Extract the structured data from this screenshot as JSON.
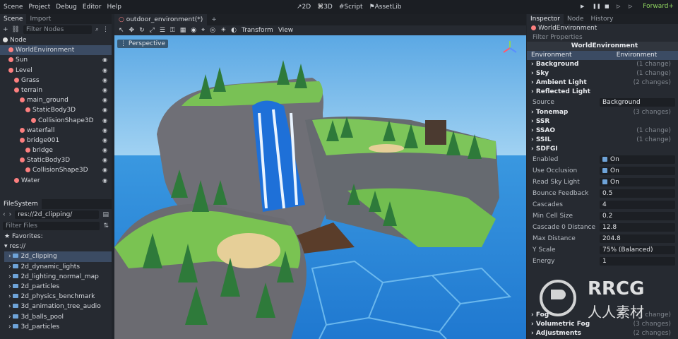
{
  "menu": [
    "Scene",
    "Project",
    "Debug",
    "Editor",
    "Help"
  ],
  "modes": [
    "2D",
    "3D",
    "Script",
    "AssetLib"
  ],
  "renderer": "Forward+",
  "scene_panel": {
    "tabs": [
      "Scene",
      "Import"
    ],
    "filter_placeholder": "Filter Nodes",
    "tree": [
      {
        "label": "Node",
        "indent": 0,
        "color": "#e0e0e0",
        "eye": false,
        "selected": false
      },
      {
        "label": "WorldEnvironment",
        "indent": 1,
        "color": "#fc7f7f",
        "eye": false,
        "selected": true
      },
      {
        "label": "Sun",
        "indent": 1,
        "color": "#fc7f7f",
        "eye": true,
        "selected": false
      },
      {
        "label": "Level",
        "indent": 1,
        "color": "#fc7f7f",
        "eye": true,
        "selected": false
      },
      {
        "label": "Grass",
        "indent": 2,
        "color": "#fc7f7f",
        "eye": true,
        "selected": false
      },
      {
        "label": "terrain",
        "indent": 2,
        "color": "#fc7f7f",
        "eye": true,
        "selected": false
      },
      {
        "label": "main_ground",
        "indent": 3,
        "color": "#fc7f7f",
        "eye": true,
        "selected": false
      },
      {
        "label": "StaticBody3D",
        "indent": 4,
        "color": "#fc7f7f",
        "eye": true,
        "selected": false
      },
      {
        "label": "CollisionShape3D",
        "indent": 5,
        "color": "#fc7f7f",
        "eye": true,
        "selected": false
      },
      {
        "label": "waterfall",
        "indent": 3,
        "color": "#fc7f7f",
        "eye": true,
        "selected": false
      },
      {
        "label": "bridge001",
        "indent": 3,
        "color": "#fc7f7f",
        "eye": true,
        "selected": false
      },
      {
        "label": "bridge",
        "indent": 4,
        "color": "#fc7f7f",
        "eye": true,
        "selected": false
      },
      {
        "label": "StaticBody3D",
        "indent": 3,
        "color": "#fc7f7f",
        "eye": true,
        "selected": false
      },
      {
        "label": "CollisionShape3D",
        "indent": 4,
        "color": "#fc7f7f",
        "eye": true,
        "selected": false
      },
      {
        "label": "Water",
        "indent": 2,
        "color": "#fc7f7f",
        "eye": true,
        "selected": false
      }
    ]
  },
  "filesystem": {
    "tab": "FileSystem",
    "path": "res://2d_clipping/",
    "filter_placeholder": "Filter Files",
    "favorites": "Favorites:",
    "root": "res://",
    "items": [
      "2d_clipping",
      "2d_dynamic_lights",
      "2d_lighting_normal_map",
      "2d_particles",
      "2d_physics_benchmark",
      "3d_animation_tree_audio",
      "3d_balls_pool",
      "3d_particles"
    ],
    "selected_index": 0
  },
  "viewport": {
    "tab_label": "outdoor_environment(*)",
    "menus": [
      "Transform",
      "View"
    ],
    "perspective": "Perspective"
  },
  "inspector": {
    "tabs": [
      "Inspector",
      "Node",
      "History"
    ],
    "object": "WorldEnvironment",
    "filter_placeholder": "Filter Properties",
    "header": "WorldEnvironment",
    "resource_label": "Environment",
    "resource_value": "Environment",
    "sections": [
      {
        "label": "Background",
        "changes": "(1 change)"
      },
      {
        "label": "Sky",
        "changes": "(1 change)"
      },
      {
        "label": "Ambient Light",
        "changes": "(2 changes)"
      },
      {
        "label": "Reflected Light",
        "changes": ""
      }
    ],
    "source_label": "Source",
    "source_value": "Background",
    "sections2": [
      {
        "label": "Tonemap",
        "changes": "(3 changes)"
      },
      {
        "label": "SSR",
        "changes": ""
      },
      {
        "label": "SSAO",
        "changes": "(1 change)"
      },
      {
        "label": "SSIL",
        "changes": "(1 change)"
      },
      {
        "label": "SDFGI",
        "changes": ""
      }
    ],
    "props": [
      {
        "label": "Enabled",
        "value": "On",
        "check": true
      },
      {
        "label": "Use Occlusion",
        "value": "On",
        "check": true
      },
      {
        "label": "Read Sky Light",
        "value": "On",
        "check": true
      },
      {
        "label": "Bounce Feedback",
        "value": "0.5",
        "check": false
      },
      {
        "label": "Cascades",
        "value": "4",
        "check": false
      },
      {
        "label": "Min Cell Size",
        "value": "0.2",
        "check": false
      },
      {
        "label": "Cascade 0 Distance",
        "value": "12.8",
        "check": false
      },
      {
        "label": "Max Distance",
        "value": "204.8",
        "check": false
      },
      {
        "label": "Y Scale",
        "value": "75% (Balanced)",
        "check": false
      },
      {
        "label": "Energy",
        "value": "1",
        "check": false
      }
    ],
    "bottom_sections": [
      {
        "label": "Fog",
        "changes": "(1 change)"
      },
      {
        "label": "Volumetric Fog",
        "changes": "(3 changes)"
      },
      {
        "label": "Adjustments",
        "changes": "(2 changes)"
      }
    ]
  },
  "watermark": {
    "line1": "RRCG",
    "line2": "人人素材"
  },
  "colors": {
    "accent": "#6ea3d8",
    "selection": "#3b4b63",
    "renderer": "#8fd35f",
    "node_icon": "#fc7f7f"
  }
}
